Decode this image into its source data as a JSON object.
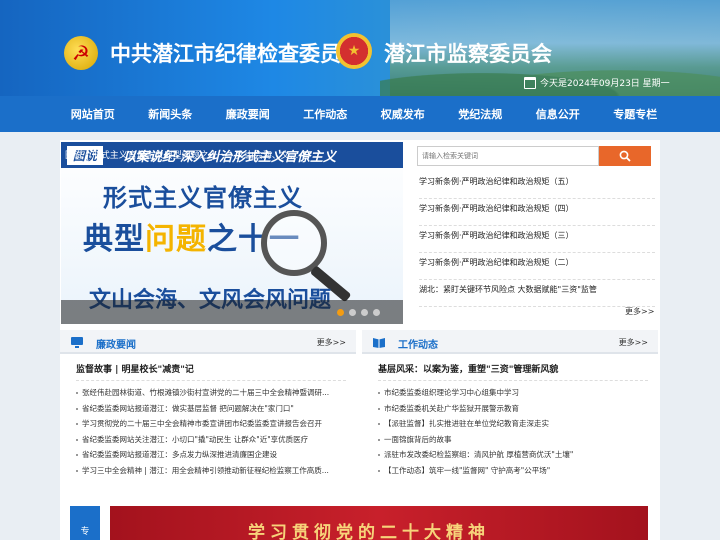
{
  "header": {
    "title_cpc": "中共潜江市纪律检查委员会",
    "title_supervision": "潜江市监察委员会",
    "date_text": "今天是2024年09月23日 星期一"
  },
  "nav": [
    "网站首页",
    "新闻头条",
    "廉政要闻",
    "工作动态",
    "权威发布",
    "党纪法规",
    "信息公开",
    "专题专栏"
  ],
  "carousel": {
    "ribbon_tag": "图说",
    "ribbon_text": "以案说纪·深入纠治形式主义官僚主义",
    "line1": "形式主义官僚主义",
    "line2a": "典型",
    "line2b": "问题",
    "line2c": "之十一",
    "line3": "文山会海、文风会风问题",
    "caption": "图说 | 形式主义官僚主义典型问题之十一：文山会海、文...",
    "slides": 4,
    "active_slide": 1
  },
  "search": {
    "placeholder": "请输入检索关键词"
  },
  "top_news": [
    "学习新条例·严明政治纪律和政治规矩（五）",
    "学习新条例·严明政治纪律和政治规矩（四）",
    "学习新条例·严明政治纪律和政治规矩（三）",
    "学习新条例·严明政治纪律和政治规矩（二）",
    "湖北：紧盯关键环节风险点 大数据赋能\"三资\"监管"
  ],
  "more_label": "更多>>",
  "box_left": {
    "title": "廉政要闻",
    "more": "更多>>",
    "lead": "监督故事 | 明星校长\"减责\"记",
    "items": [
      "张经伟赴园林街道、竹根滩镇沙街村宣讲党的二十届三中全会精神暨调研...",
      "省纪委监委网站报道潜江：做实基层监督 把问题解决在\"家门口\"",
      "学习贯彻党的二十届三中全会精神市委宣讲团市纪委监委宣讲报告会召开",
      "省纪委监委网站关注潜江：小切口\"撬\"动民生 让群众\"近\"享优质医疗",
      "省纪委监委网站报道潜江：多点发力纵深推进清廉国企建设",
      "学习三中全会精神 | 潜江：用全会精神引领推动新征程纪检监察工作高质..."
    ]
  },
  "box_right": {
    "title": "工作动态",
    "more": "更多>>",
    "lead": "基层风采：以案为鉴，重塑\"三资\"管理新风貌",
    "items": [
      "市纪委监委组织理论学习中心组集中学习",
      "市纪委监委机关赴广华监狱开展警示教育",
      "【派驻监督】扎实推进驻在单位党纪教育走深走实",
      "一面锦旗背后的故事",
      "派驻市发改委纪检监察组：清风护航 厚植营商优沃\"土壤\"",
      "【工作动态】筑牢一线\"监督网\" 守护高考\"公平场\""
    ]
  },
  "side_tab": "专",
  "banner_text": "学习贯彻党的二十大精神",
  "colors": {
    "nav_blue": "#1b6fc9",
    "accent_orange": "#e8672a",
    "banner_red": "#c8202b"
  }
}
